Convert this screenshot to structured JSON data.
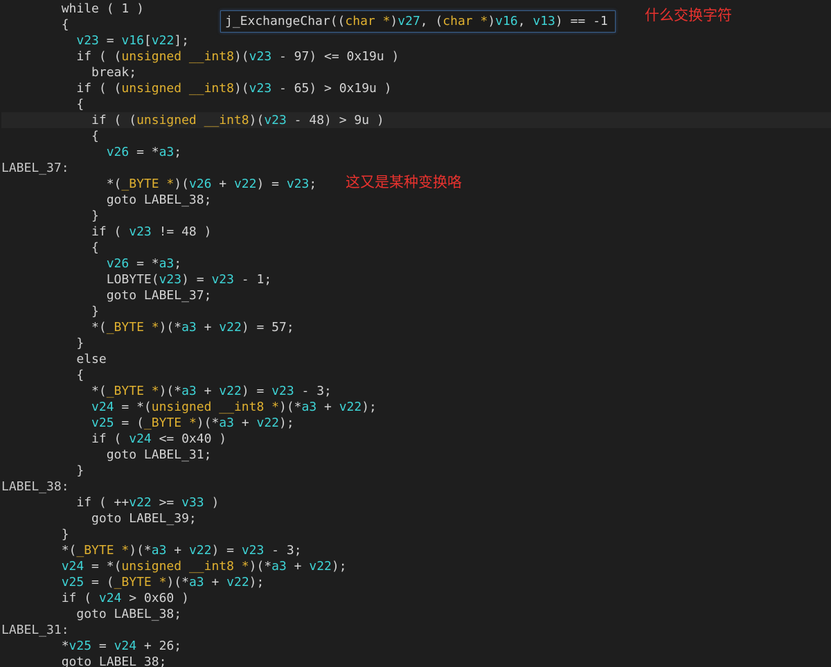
{
  "palette": {
    "background": "#1e1e1e",
    "plain": "#d4d4d4",
    "variable": "#3ed4d6",
    "type": "#e0b130",
    "annotation": "#e8322e",
    "tooltip_border": "#3a5f8a"
  },
  "tooltip": {
    "tokens": [
      {
        "t": "j_ExchangeChar((",
        "c": "plain"
      },
      {
        "t": "char *",
        "c": "type"
      },
      {
        "t": ")",
        "c": "plain"
      },
      {
        "t": "v27",
        "c": "var"
      },
      {
        "t": ", (",
        "c": "plain"
      },
      {
        "t": "char *",
        "c": "type"
      },
      {
        "t": ")",
        "c": "plain"
      },
      {
        "t": "v16",
        "c": "var"
      },
      {
        "t": ", ",
        "c": "plain"
      },
      {
        "t": "v13",
        "c": "var"
      },
      {
        "t": ") == -1",
        "c": "plain"
      }
    ]
  },
  "annotations": {
    "exchange_char": "什么交换字符",
    "transform": "这又是某种变换咯"
  },
  "code": {
    "lines": [
      {
        "tokens": [
          {
            "t": "        while ( 1 )",
            "c": "plain"
          }
        ]
      },
      {
        "tokens": [
          {
            "t": "        {",
            "c": "plain"
          }
        ]
      },
      {
        "tokens": [
          {
            "t": "          ",
            "c": "plain"
          },
          {
            "t": "v23",
            "c": "var"
          },
          {
            "t": " = ",
            "c": "plain"
          },
          {
            "t": "v16",
            "c": "var"
          },
          {
            "t": "[",
            "c": "plain"
          },
          {
            "t": "v22",
            "c": "var"
          },
          {
            "t": "];",
            "c": "plain"
          }
        ]
      },
      {
        "tokens": [
          {
            "t": "          if ( (",
            "c": "plain"
          },
          {
            "t": "unsigned __int8",
            "c": "type"
          },
          {
            "t": ")(",
            "c": "plain"
          },
          {
            "t": "v23",
            "c": "var"
          },
          {
            "t": " - 97) <= 0x19u )",
            "c": "plain"
          }
        ]
      },
      {
        "tokens": [
          {
            "t": "            break;",
            "c": "plain"
          }
        ]
      },
      {
        "tokens": [
          {
            "t": "          if ( (",
            "c": "plain"
          },
          {
            "t": "unsigned __int8",
            "c": "type"
          },
          {
            "t": ")(",
            "c": "plain"
          },
          {
            "t": "v23",
            "c": "var"
          },
          {
            "t": " - 65) > 0x19u )",
            "c": "plain"
          }
        ]
      },
      {
        "tokens": [
          {
            "t": "          {",
            "c": "plain"
          }
        ]
      },
      {
        "current": true,
        "tokens": [
          {
            "t": "            if ( (",
            "c": "plain"
          },
          {
            "t": "unsigned __int8",
            "c": "type"
          },
          {
            "t": ")(",
            "c": "plain"
          },
          {
            "t": "v23",
            "c": "var"
          },
          {
            "t": " - 48) > 9u )",
            "c": "plain"
          }
        ]
      },
      {
        "tokens": [
          {
            "t": "            {",
            "c": "plain"
          }
        ]
      },
      {
        "tokens": [
          {
            "t": "              ",
            "c": "plain"
          },
          {
            "t": "v26",
            "c": "var"
          },
          {
            "t": " = *",
            "c": "plain"
          },
          {
            "t": "a3",
            "c": "var"
          },
          {
            "t": ";",
            "c": "plain"
          }
        ]
      },
      {
        "tokens": [
          {
            "t": "LABEL_37:",
            "c": "label"
          }
        ]
      },
      {
        "tokens": [
          {
            "t": "              *(",
            "c": "plain"
          },
          {
            "t": "_BYTE *",
            "c": "type"
          },
          {
            "t": ")(",
            "c": "plain"
          },
          {
            "t": "v26",
            "c": "var"
          },
          {
            "t": " + ",
            "c": "plain"
          },
          {
            "t": "v22",
            "c": "var"
          },
          {
            "t": ") = ",
            "c": "plain"
          },
          {
            "t": "v23",
            "c": "var"
          },
          {
            "t": ";",
            "c": "plain"
          }
        ]
      },
      {
        "tokens": [
          {
            "t": "              goto LABEL_38;",
            "c": "plain"
          }
        ]
      },
      {
        "tokens": [
          {
            "t": "            }",
            "c": "plain"
          }
        ]
      },
      {
        "tokens": [
          {
            "t": "            if ( ",
            "c": "plain"
          },
          {
            "t": "v23",
            "c": "var"
          },
          {
            "t": " != 48 )",
            "c": "plain"
          }
        ]
      },
      {
        "tokens": [
          {
            "t": "            {",
            "c": "plain"
          }
        ]
      },
      {
        "tokens": [
          {
            "t": "              ",
            "c": "plain"
          },
          {
            "t": "v26",
            "c": "var"
          },
          {
            "t": " = *",
            "c": "plain"
          },
          {
            "t": "a3",
            "c": "var"
          },
          {
            "t": ";",
            "c": "plain"
          }
        ]
      },
      {
        "tokens": [
          {
            "t": "              LOBYTE(",
            "c": "plain"
          },
          {
            "t": "v23",
            "c": "var"
          },
          {
            "t": ") = ",
            "c": "plain"
          },
          {
            "t": "v23",
            "c": "var"
          },
          {
            "t": " - 1;",
            "c": "plain"
          }
        ]
      },
      {
        "tokens": [
          {
            "t": "              goto LABEL_37;",
            "c": "plain"
          }
        ]
      },
      {
        "tokens": [
          {
            "t": "            }",
            "c": "plain"
          }
        ]
      },
      {
        "tokens": [
          {
            "t": "            *(",
            "c": "plain"
          },
          {
            "t": "_BYTE *",
            "c": "type"
          },
          {
            "t": ")(*",
            "c": "plain"
          },
          {
            "t": "a3",
            "c": "var"
          },
          {
            "t": " + ",
            "c": "plain"
          },
          {
            "t": "v22",
            "c": "var"
          },
          {
            "t": ") = 57;",
            "c": "plain"
          }
        ]
      },
      {
        "tokens": [
          {
            "t": "          }",
            "c": "plain"
          }
        ]
      },
      {
        "tokens": [
          {
            "t": "          else",
            "c": "plain"
          }
        ]
      },
      {
        "tokens": [
          {
            "t": "          {",
            "c": "plain"
          }
        ]
      },
      {
        "tokens": [
          {
            "t": "            *(",
            "c": "plain"
          },
          {
            "t": "_BYTE *",
            "c": "type"
          },
          {
            "t": ")(*",
            "c": "plain"
          },
          {
            "t": "a3",
            "c": "var"
          },
          {
            "t": " + ",
            "c": "plain"
          },
          {
            "t": "v22",
            "c": "var"
          },
          {
            "t": ") = ",
            "c": "plain"
          },
          {
            "t": "v23",
            "c": "var"
          },
          {
            "t": " - 3;",
            "c": "plain"
          }
        ]
      },
      {
        "tokens": [
          {
            "t": "            ",
            "c": "plain"
          },
          {
            "t": "v24",
            "c": "var"
          },
          {
            "t": " = *(",
            "c": "plain"
          },
          {
            "t": "unsigned __int8 *",
            "c": "type"
          },
          {
            "t": ")(*",
            "c": "plain"
          },
          {
            "t": "a3",
            "c": "var"
          },
          {
            "t": " + ",
            "c": "plain"
          },
          {
            "t": "v22",
            "c": "var"
          },
          {
            "t": ");",
            "c": "plain"
          }
        ]
      },
      {
        "tokens": [
          {
            "t": "            ",
            "c": "plain"
          },
          {
            "t": "v25",
            "c": "var"
          },
          {
            "t": " = (",
            "c": "plain"
          },
          {
            "t": "_BYTE *",
            "c": "type"
          },
          {
            "t": ")(*",
            "c": "plain"
          },
          {
            "t": "a3",
            "c": "var"
          },
          {
            "t": " + ",
            "c": "plain"
          },
          {
            "t": "v22",
            "c": "var"
          },
          {
            "t": ");",
            "c": "plain"
          }
        ]
      },
      {
        "tokens": [
          {
            "t": "            if ( ",
            "c": "plain"
          },
          {
            "t": "v24",
            "c": "var"
          },
          {
            "t": " <= 0x40 )",
            "c": "plain"
          }
        ]
      },
      {
        "tokens": [
          {
            "t": "              goto LABEL_31;",
            "c": "plain"
          }
        ]
      },
      {
        "tokens": [
          {
            "t": "          }",
            "c": "plain"
          }
        ]
      },
      {
        "tokens": [
          {
            "t": "LABEL_38:",
            "c": "label"
          }
        ]
      },
      {
        "tokens": [
          {
            "t": "          if ( ++",
            "c": "plain"
          },
          {
            "t": "v22",
            "c": "var"
          },
          {
            "t": " >= ",
            "c": "plain"
          },
          {
            "t": "v33",
            "c": "var"
          },
          {
            "t": " )",
            "c": "plain"
          }
        ]
      },
      {
        "tokens": [
          {
            "t": "            goto LABEL_39;",
            "c": "plain"
          }
        ]
      },
      {
        "tokens": [
          {
            "t": "        }",
            "c": "plain"
          }
        ]
      },
      {
        "tokens": [
          {
            "t": "        *(",
            "c": "plain"
          },
          {
            "t": "_BYTE *",
            "c": "type"
          },
          {
            "t": ")(*",
            "c": "plain"
          },
          {
            "t": "a3",
            "c": "var"
          },
          {
            "t": " + ",
            "c": "plain"
          },
          {
            "t": "v22",
            "c": "var"
          },
          {
            "t": ") = ",
            "c": "plain"
          },
          {
            "t": "v23",
            "c": "var"
          },
          {
            "t": " - 3;",
            "c": "plain"
          }
        ]
      },
      {
        "tokens": [
          {
            "t": "        ",
            "c": "plain"
          },
          {
            "t": "v24",
            "c": "var"
          },
          {
            "t": " = *(",
            "c": "plain"
          },
          {
            "t": "unsigned __int8 *",
            "c": "type"
          },
          {
            "t": ")(*",
            "c": "plain"
          },
          {
            "t": "a3",
            "c": "var"
          },
          {
            "t": " + ",
            "c": "plain"
          },
          {
            "t": "v22",
            "c": "var"
          },
          {
            "t": ");",
            "c": "plain"
          }
        ]
      },
      {
        "tokens": [
          {
            "t": "        ",
            "c": "plain"
          },
          {
            "t": "v25",
            "c": "var"
          },
          {
            "t": " = (",
            "c": "plain"
          },
          {
            "t": "_BYTE *",
            "c": "type"
          },
          {
            "t": ")(*",
            "c": "plain"
          },
          {
            "t": "a3",
            "c": "var"
          },
          {
            "t": " + ",
            "c": "plain"
          },
          {
            "t": "v22",
            "c": "var"
          },
          {
            "t": ");",
            "c": "plain"
          }
        ]
      },
      {
        "tokens": [
          {
            "t": "        if ( ",
            "c": "plain"
          },
          {
            "t": "v24",
            "c": "var"
          },
          {
            "t": " > 0x60 )",
            "c": "plain"
          }
        ]
      },
      {
        "tokens": [
          {
            "t": "          goto LABEL_38;",
            "c": "plain"
          }
        ]
      },
      {
        "tokens": [
          {
            "t": "LABEL_31:",
            "c": "label"
          }
        ]
      },
      {
        "tokens": [
          {
            "t": "        *",
            "c": "plain"
          },
          {
            "t": "v25",
            "c": "var"
          },
          {
            "t": " = ",
            "c": "plain"
          },
          {
            "t": "v24",
            "c": "var"
          },
          {
            "t": " + 26;",
            "c": "plain"
          }
        ]
      },
      {
        "tokens": [
          {
            "t": "        goto LABEL_38;",
            "c": "plain"
          }
        ]
      }
    ]
  }
}
